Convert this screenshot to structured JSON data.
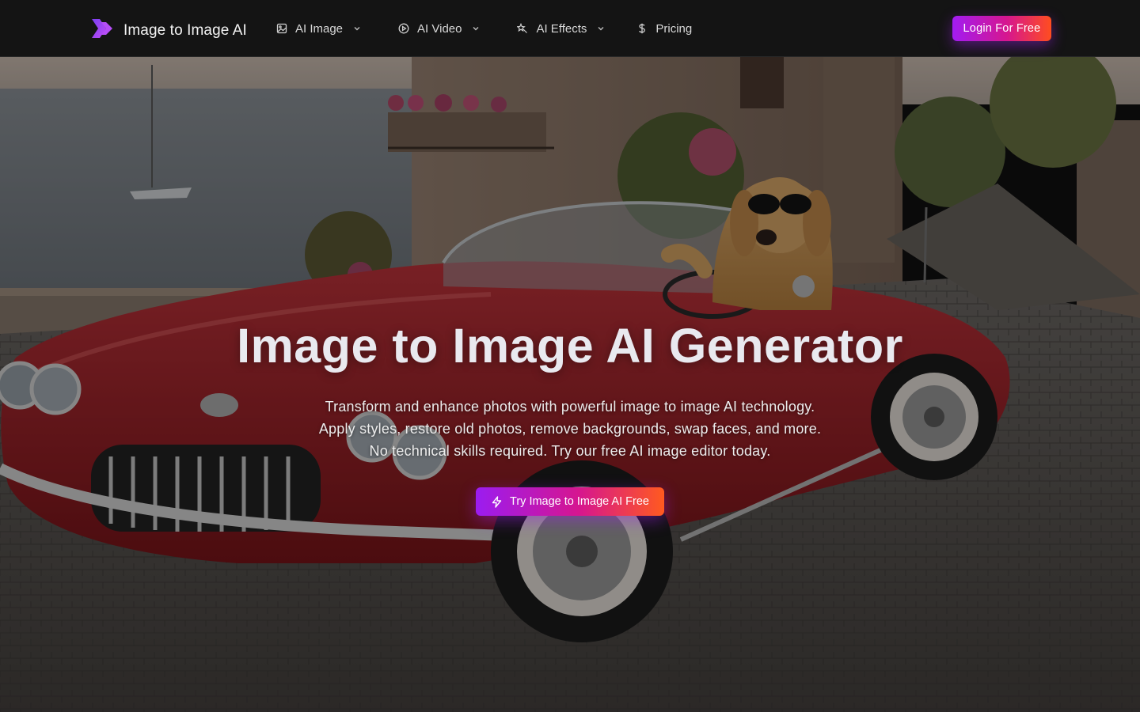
{
  "brand": {
    "name": "Image to Image AI",
    "logo_icon": "chevron-double-right-logo"
  },
  "nav": {
    "items": [
      {
        "label": "AI Image",
        "icon": "image-icon",
        "has_dropdown": true
      },
      {
        "label": "AI Video",
        "icon": "play-circle-icon",
        "has_dropdown": true
      },
      {
        "label": "AI Effects",
        "icon": "sparkle-wand-icon",
        "has_dropdown": true
      },
      {
        "label": "Pricing",
        "icon": "dollar-icon",
        "has_dropdown": false
      }
    ],
    "login_label": "Login For Free"
  },
  "hero": {
    "title": "Image to Image AI Generator",
    "description_lines": [
      "Transform and enhance photos with powerful image to image AI technology.",
      "Apply styles, restore old photos, remove backgrounds, swap faces, and more.",
      "No technical skills required. Try our free AI image editor today."
    ],
    "cta_label": "Try Image to Image AI Free",
    "cta_icon": "lightning-icon"
  },
  "colors": {
    "nav_bg": "#141414",
    "gradient_start": "#a21cf2",
    "gradient_mid": "#d6168f",
    "gradient_end": "#ff4d1f"
  }
}
